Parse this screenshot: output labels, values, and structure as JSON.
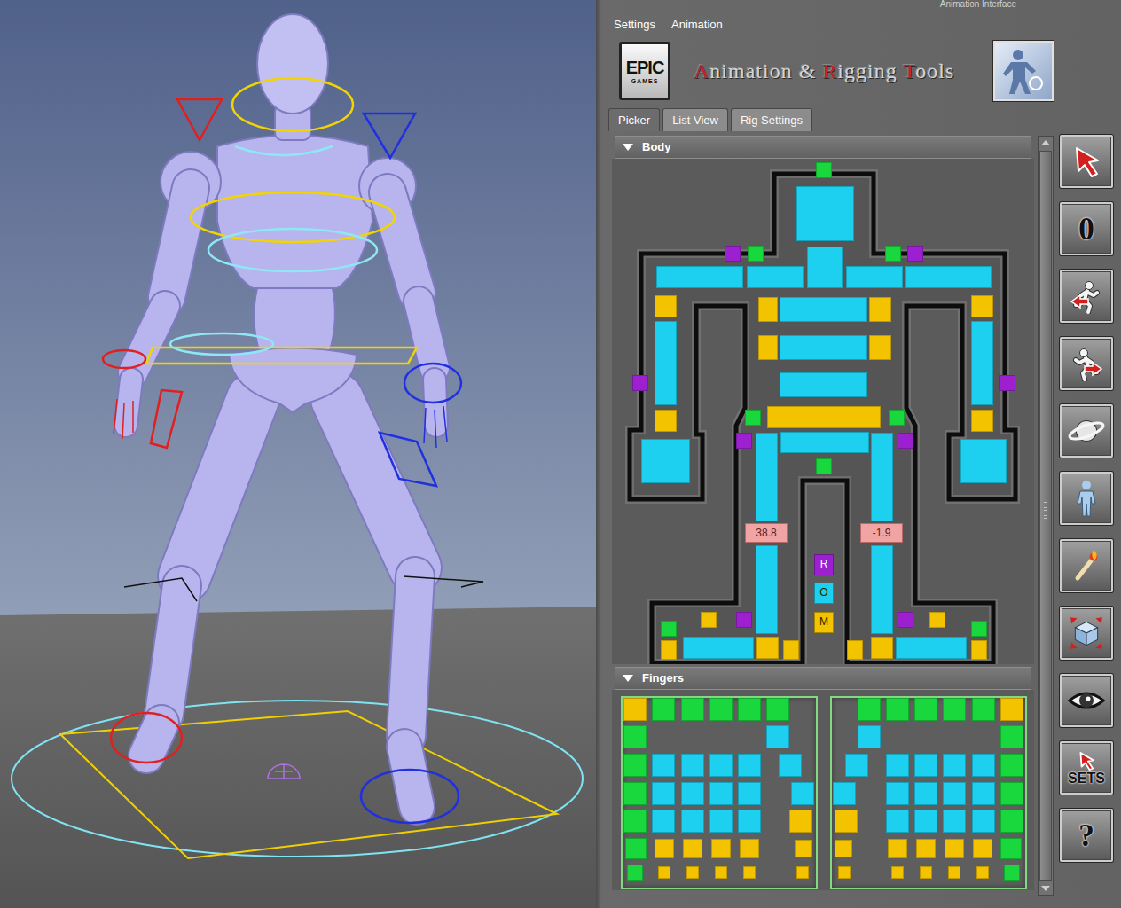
{
  "window": {
    "title": "Animation Interface"
  },
  "menu": [
    {
      "label": "Settings"
    },
    {
      "label": "Animation"
    }
  ],
  "logo": {
    "word": "EPIC",
    "sub": "GAMES"
  },
  "title_parts": [
    {
      "text": "A",
      "accent": true
    },
    {
      "text": "nimation & ",
      "accent": false
    },
    {
      "text": "R",
      "accent": true
    },
    {
      "text": "igging ",
      "accent": false
    },
    {
      "text": "T",
      "accent": true
    },
    {
      "text": "ools",
      "accent": false
    }
  ],
  "tabs": [
    {
      "label": "Picker",
      "selected": true
    },
    {
      "label": "List View",
      "selected": false
    },
    {
      "label": "Rig Settings",
      "selected": false
    }
  ],
  "body": {
    "title": "Body",
    "expanded": true,
    "controls": [
      {
        "color": "#18d83e"
      },
      {
        "color": "#1dd0f0"
      },
      {
        "color": "#1dd0f0"
      },
      {
        "color": "#9c20d0"
      },
      {
        "color": "#18d83e"
      },
      {
        "color": "#18d83e"
      },
      {
        "color": "#9c20d0"
      },
      {
        "color": "#1dd0f0"
      },
      {
        "color": "#1dd0f0"
      },
      {
        "color": "#1dd0f0"
      },
      {
        "color": "#1dd0f0"
      },
      {
        "color": "#f3c300"
      },
      {
        "color": "#1dd0f0"
      },
      {
        "color": "#f3c300"
      },
      {
        "color": "#f3c300"
      },
      {
        "color": "#1dd0f0"
      },
      {
        "color": "#f3c300"
      },
      {
        "color": "#1dd0f0"
      },
      {
        "color": "#f3c300"
      },
      {
        "color": "#18d83e"
      },
      {
        "color": "#18d83e"
      },
      {
        "color": "#9c20d0"
      },
      {
        "color": "#1dd0f0"
      },
      {
        "color": "#9c20d0"
      },
      {
        "color": "#1dd0f0"
      },
      {
        "color": "#1dd0f0"
      },
      {
        "color": "#18d83e"
      },
      {
        "color": "#1dd0f0"
      },
      {
        "color": "#1dd0f0"
      },
      {
        "color": "#18d83e"
      },
      {
        "color": "#f3c300"
      },
      {
        "color": "#9c20d0"
      },
      {
        "color": "#f3c300"
      },
      {
        "color": "#1dd0f0"
      },
      {
        "color": "#f3c300"
      },
      {
        "color": "#f3c300"
      },
      {
        "color": "#f3c300"
      },
      {
        "color": "#f3c300"
      },
      {
        "color": "#1dd0f0"
      },
      {
        "color": "#9c20d0"
      },
      {
        "color": "#f3c300"
      },
      {
        "color": "#18d83e"
      },
      {
        "color": "#f3c300"
      },
      {
        "color": "#f3c300"
      },
      {
        "color": "#1dd0f0"
      },
      {
        "color": "#9c20d0"
      },
      {
        "color": "#f3c300"
      },
      {
        "color": "#1dd0f0"
      },
      {
        "color": "#f3c300"
      },
      {
        "color": "#1dd0f0"
      },
      {
        "color": "#9c20d0"
      },
      {
        "color": "#f3c300"
      },
      {
        "color": "#1dd0f0"
      }
    ],
    "readouts": [
      {
        "text": "38.8"
      },
      {
        "text": "-1.9"
      }
    ],
    "spaces": [
      {
        "label": "R",
        "color": "#9c20d0"
      },
      {
        "label": "O",
        "color": "#1dd0f0"
      },
      {
        "label": "M",
        "color": "#f3c300"
      }
    ]
  },
  "fingers": {
    "title": "Fingers",
    "expanded": true,
    "hands": [
      {
        "cells": [
          {
            "color": "#f3c300"
          },
          {
            "color": "#18d83e"
          },
          {
            "color": "#18d83e"
          },
          {
            "color": "#18d83e"
          },
          {
            "color": "#18d83e"
          },
          {
            "color": "#18d83e"
          },
          {
            "color": "#18d83e"
          },
          {
            "color": "#1dd0f0"
          },
          {
            "color": "#18d83e"
          },
          {
            "color": "#1dd0f0"
          },
          {
            "color": "#1dd0f0"
          },
          {
            "color": "#1dd0f0"
          },
          {
            "color": "#1dd0f0"
          },
          {
            "color": "#1dd0f0"
          },
          {
            "color": "#18d83e"
          },
          {
            "color": "#1dd0f0"
          },
          {
            "color": "#1dd0f0"
          },
          {
            "color": "#1dd0f0"
          },
          {
            "color": "#1dd0f0"
          },
          {
            "color": "#1dd0f0"
          },
          {
            "color": "#18d83e"
          },
          {
            "color": "#1dd0f0"
          },
          {
            "color": "#1dd0f0"
          },
          {
            "color": "#1dd0f0"
          },
          {
            "color": "#1dd0f0"
          },
          {
            "color": "#f3c300"
          },
          {
            "color": "#18d83e"
          },
          {
            "color": "#f3c300"
          },
          {
            "color": "#f3c300"
          },
          {
            "color": "#f3c300"
          },
          {
            "color": "#f3c300"
          },
          {
            "color": "#f3c300"
          },
          {
            "color": "#18d83e"
          },
          {
            "color": "#f3c300"
          },
          {
            "color": "#f3c300"
          },
          {
            "color": "#f3c300"
          },
          {
            "color": "#f3c300"
          },
          {
            "color": "#f3c300"
          }
        ]
      },
      {
        "cells": [
          {
            "color": "#f3c300"
          },
          {
            "color": "#18d83e"
          },
          {
            "color": "#18d83e"
          },
          {
            "color": "#18d83e"
          },
          {
            "color": "#18d83e"
          },
          {
            "color": "#18d83e"
          },
          {
            "color": "#18d83e"
          },
          {
            "color": "#1dd0f0"
          },
          {
            "color": "#18d83e"
          },
          {
            "color": "#1dd0f0"
          },
          {
            "color": "#1dd0f0"
          },
          {
            "color": "#1dd0f0"
          },
          {
            "color": "#1dd0f0"
          },
          {
            "color": "#1dd0f0"
          },
          {
            "color": "#18d83e"
          },
          {
            "color": "#1dd0f0"
          },
          {
            "color": "#1dd0f0"
          },
          {
            "color": "#1dd0f0"
          },
          {
            "color": "#1dd0f0"
          },
          {
            "color": "#1dd0f0"
          },
          {
            "color": "#18d83e"
          },
          {
            "color": "#1dd0f0"
          },
          {
            "color": "#1dd0f0"
          },
          {
            "color": "#1dd0f0"
          },
          {
            "color": "#1dd0f0"
          },
          {
            "color": "#f3c300"
          },
          {
            "color": "#18d83e"
          },
          {
            "color": "#f3c300"
          },
          {
            "color": "#f3c300"
          },
          {
            "color": "#f3c300"
          },
          {
            "color": "#f3c300"
          },
          {
            "color": "#f3c300"
          },
          {
            "color": "#18d83e"
          },
          {
            "color": "#f3c300"
          },
          {
            "color": "#f3c300"
          },
          {
            "color": "#f3c300"
          },
          {
            "color": "#f3c300"
          },
          {
            "color": "#f3c300"
          }
        ]
      }
    ]
  },
  "toolbar": [
    {
      "kind": "icon"
    },
    {
      "kind": "text",
      "label": "0"
    },
    {
      "kind": "icon"
    },
    {
      "kind": "icon"
    },
    {
      "kind": "icon"
    },
    {
      "kind": "icon"
    },
    {
      "kind": "icon"
    },
    {
      "kind": "icon"
    },
    {
      "kind": "icon"
    },
    {
      "kind": "icon-text",
      "label": "SETS"
    },
    {
      "kind": "text",
      "label": "?"
    }
  ]
}
